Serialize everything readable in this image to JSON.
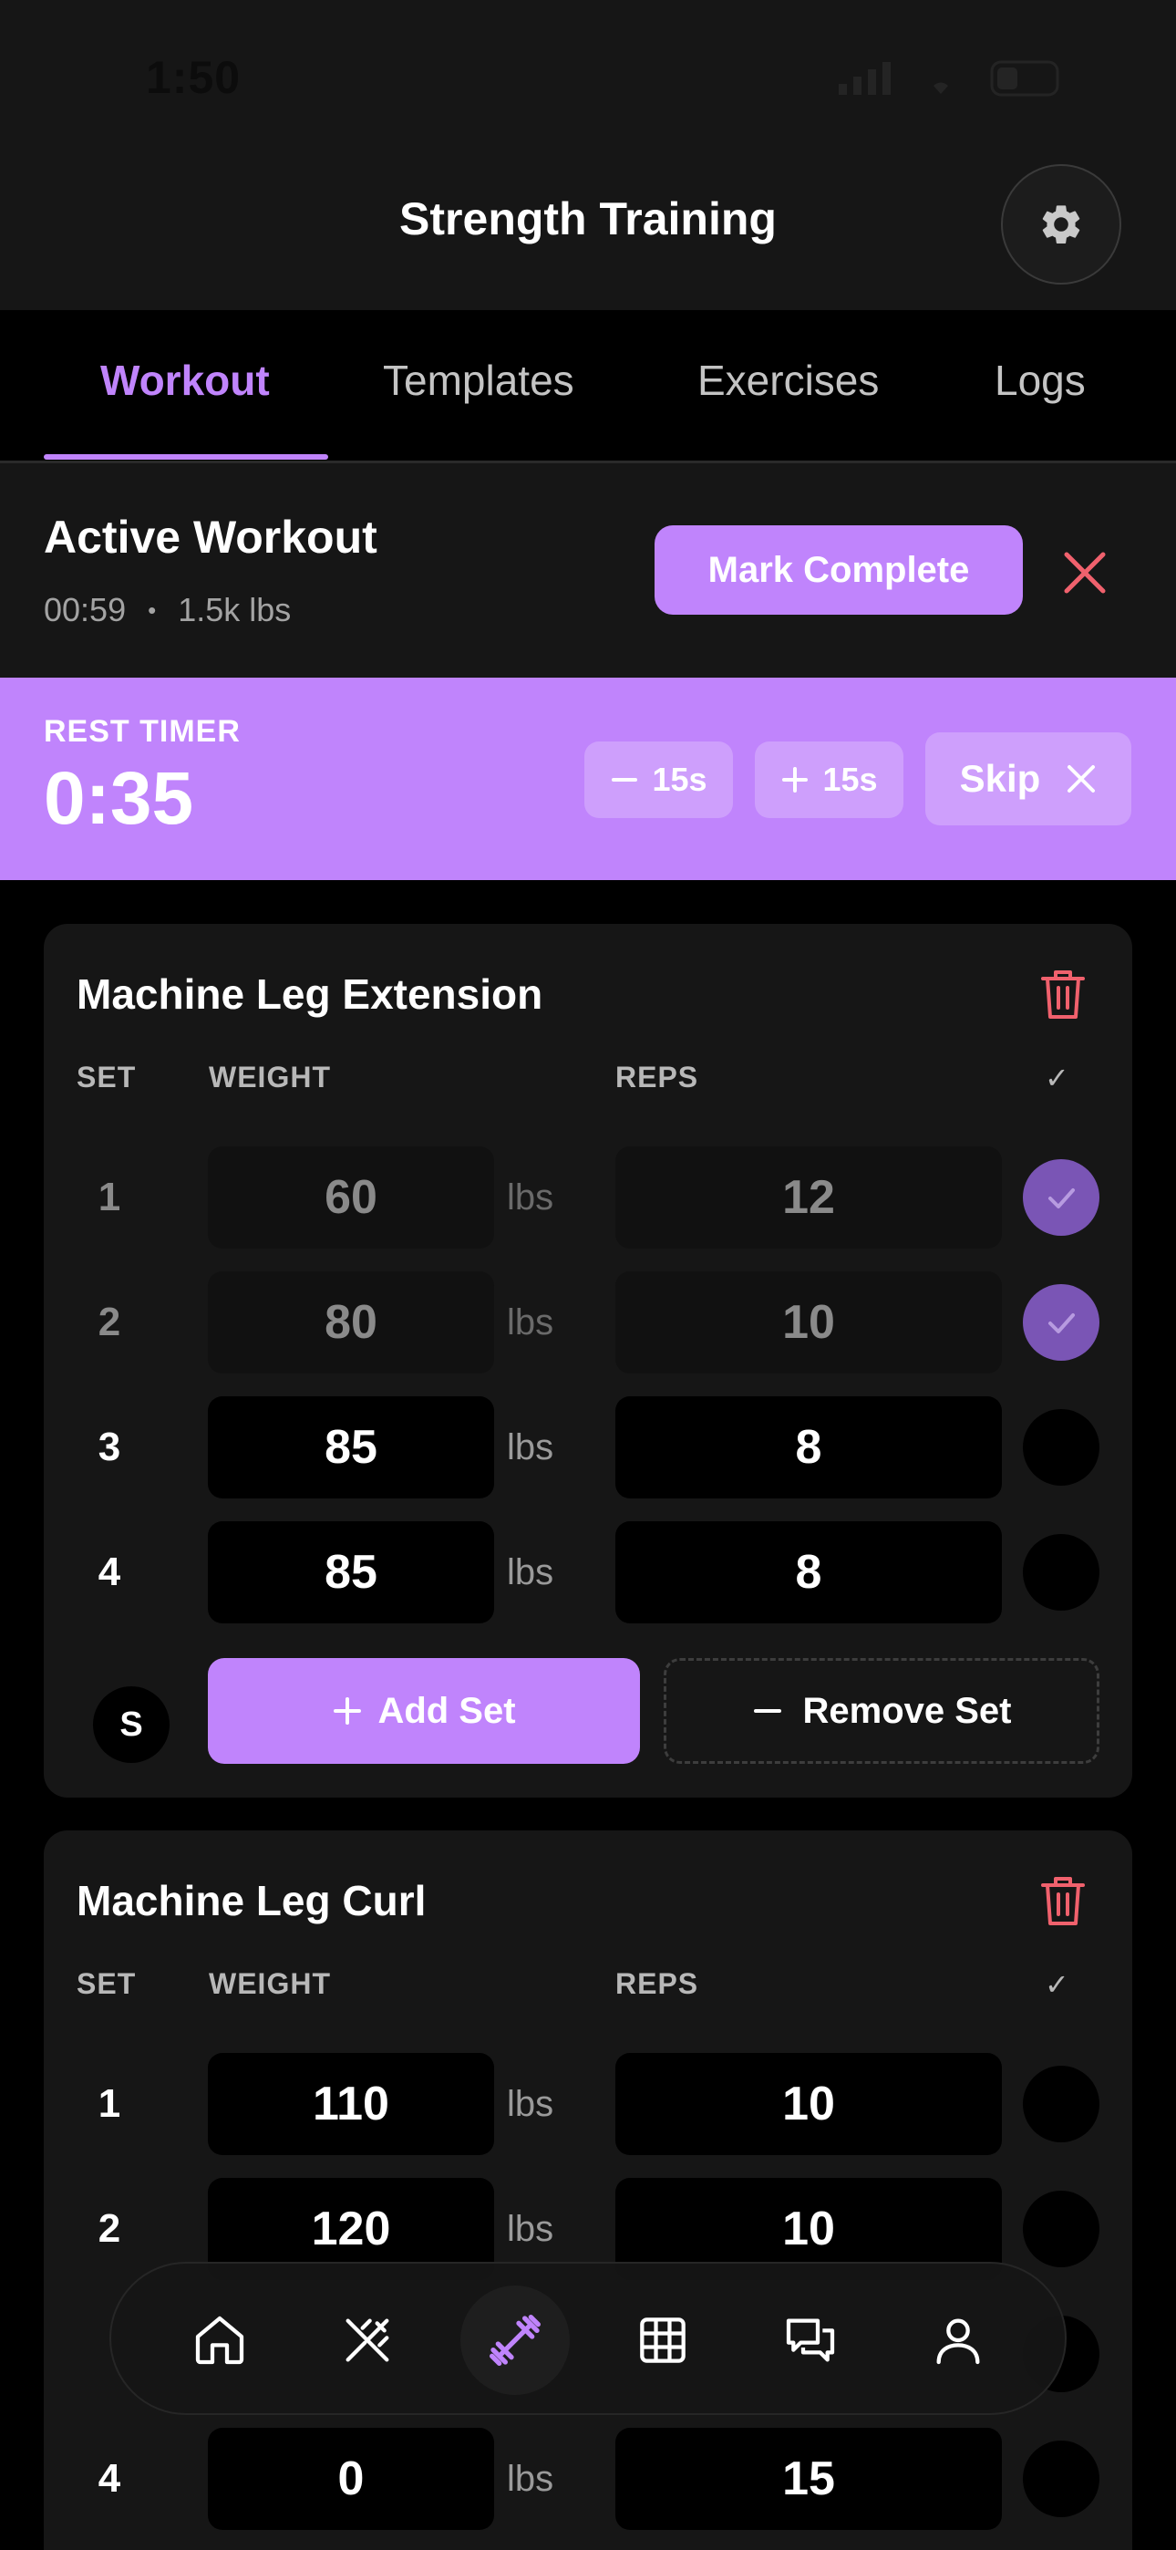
{
  "status_bar": {
    "time": "1:50"
  },
  "header": {
    "title": "Strength Training"
  },
  "tabs": [
    {
      "label": "Workout",
      "active": true
    },
    {
      "label": "Templates",
      "active": false
    },
    {
      "label": "Exercises",
      "active": false
    },
    {
      "label": "Logs",
      "active": false
    }
  ],
  "active_workout": {
    "title": "Active Workout",
    "elapsed": "00:59",
    "separator": "•",
    "volume": "1.5k lbs",
    "mark_complete_label": "Mark Complete"
  },
  "rest_timer": {
    "label": "REST TIMER",
    "value": "0:35",
    "minus_label": "15s",
    "plus_label": "15s",
    "skip_label": "Skip"
  },
  "column_headers": {
    "set": "SET",
    "weight": "WEIGHT",
    "reps": "REPS",
    "check": "✓"
  },
  "exercises": [
    {
      "name": "Machine Leg Extension",
      "sets": [
        {
          "num": "1",
          "weight": "60",
          "unit": "lbs",
          "reps": "12",
          "done": true
        },
        {
          "num": "2",
          "weight": "80",
          "unit": "lbs",
          "reps": "10",
          "done": true
        },
        {
          "num": "3",
          "weight": "85",
          "unit": "lbs",
          "reps": "8",
          "done": false
        },
        {
          "num": "4",
          "weight": "85",
          "unit": "lbs",
          "reps": "8",
          "done": false
        }
      ],
      "s_badge": "S",
      "add_set_label": "Add Set",
      "remove_set_label": "Remove Set"
    },
    {
      "name": "Machine Leg Curl",
      "sets": [
        {
          "num": "1",
          "weight": "110",
          "unit": "lbs",
          "reps": "10",
          "done": false
        },
        {
          "num": "2",
          "weight": "120",
          "unit": "lbs",
          "reps": "10",
          "done": false
        },
        {
          "num": "4",
          "weight": "0",
          "unit": "lbs",
          "reps": "15",
          "done": false
        }
      ]
    }
  ],
  "bottom_nav": [
    {
      "icon": "home-icon",
      "active": false
    },
    {
      "icon": "fork-knife-icon",
      "active": false
    },
    {
      "icon": "dumbbell-icon",
      "active": true
    },
    {
      "icon": "grid-icon",
      "active": false
    },
    {
      "icon": "chat-icon",
      "active": false
    },
    {
      "icon": "profile-icon",
      "active": false
    }
  ],
  "colors": {
    "accent": "#c084fc",
    "danger": "#f0616d",
    "background": "#000000",
    "surface": "#161616"
  }
}
